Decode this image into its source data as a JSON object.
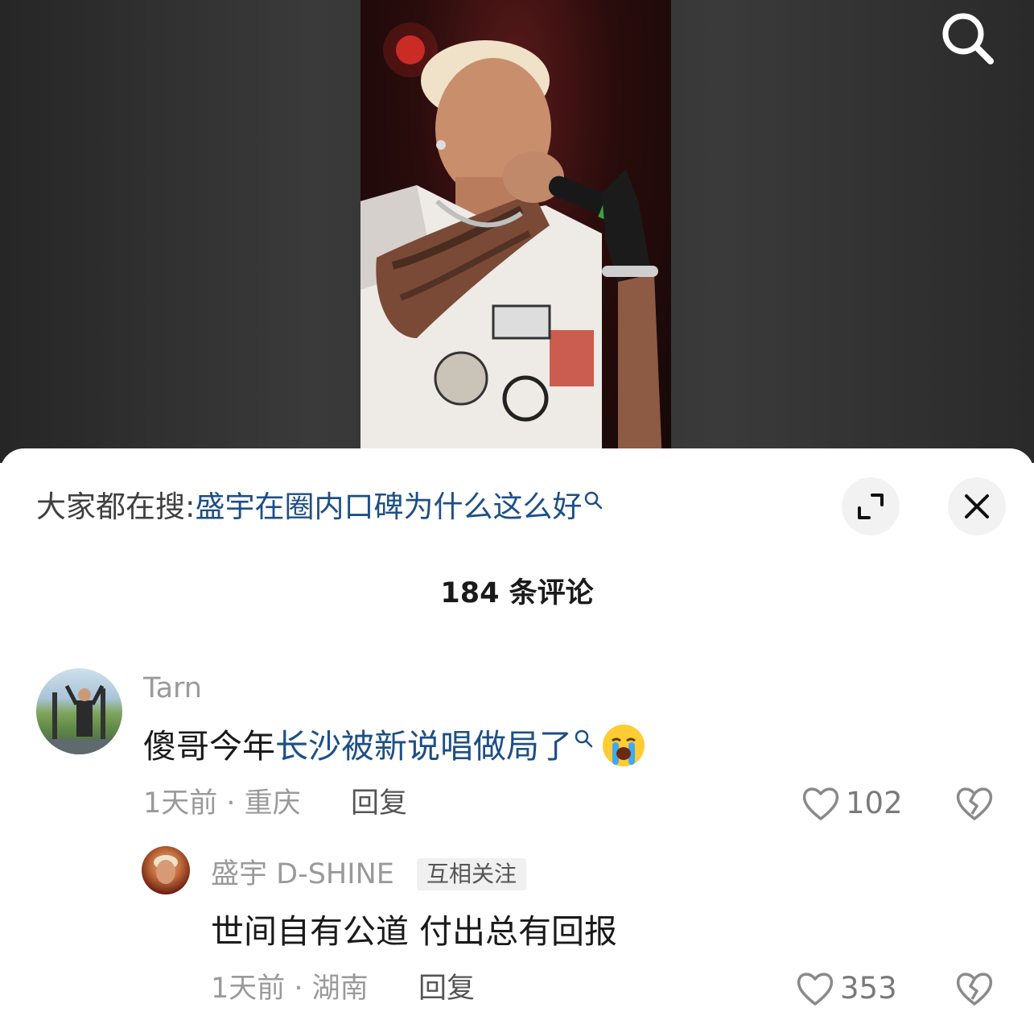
{
  "search_suggestion": {
    "prefix": "大家都在搜:",
    "query": "盛宇在圈内口碑为什么这么好"
  },
  "comments_header": {
    "title": "184 条评论"
  },
  "comments": [
    {
      "username": "Tarn",
      "text_plain": "傻哥今年",
      "text_link": "长沙被新说唱做局了",
      "emoji": "loudly-crying-face",
      "meta": "1天前 · 重庆",
      "reply_label": "回复",
      "likes": "102"
    }
  ],
  "reply": {
    "username": "盛宇 D-SHINE",
    "badge": "互相关注",
    "text": "世间自有公道 付出总有回报",
    "meta": "1天前 · 湖南",
    "reply_label": "回复",
    "likes": "353"
  },
  "colors": {
    "link": "#1d4f86",
    "muted": "#9a9a9a",
    "text": "#1a1a1a"
  }
}
